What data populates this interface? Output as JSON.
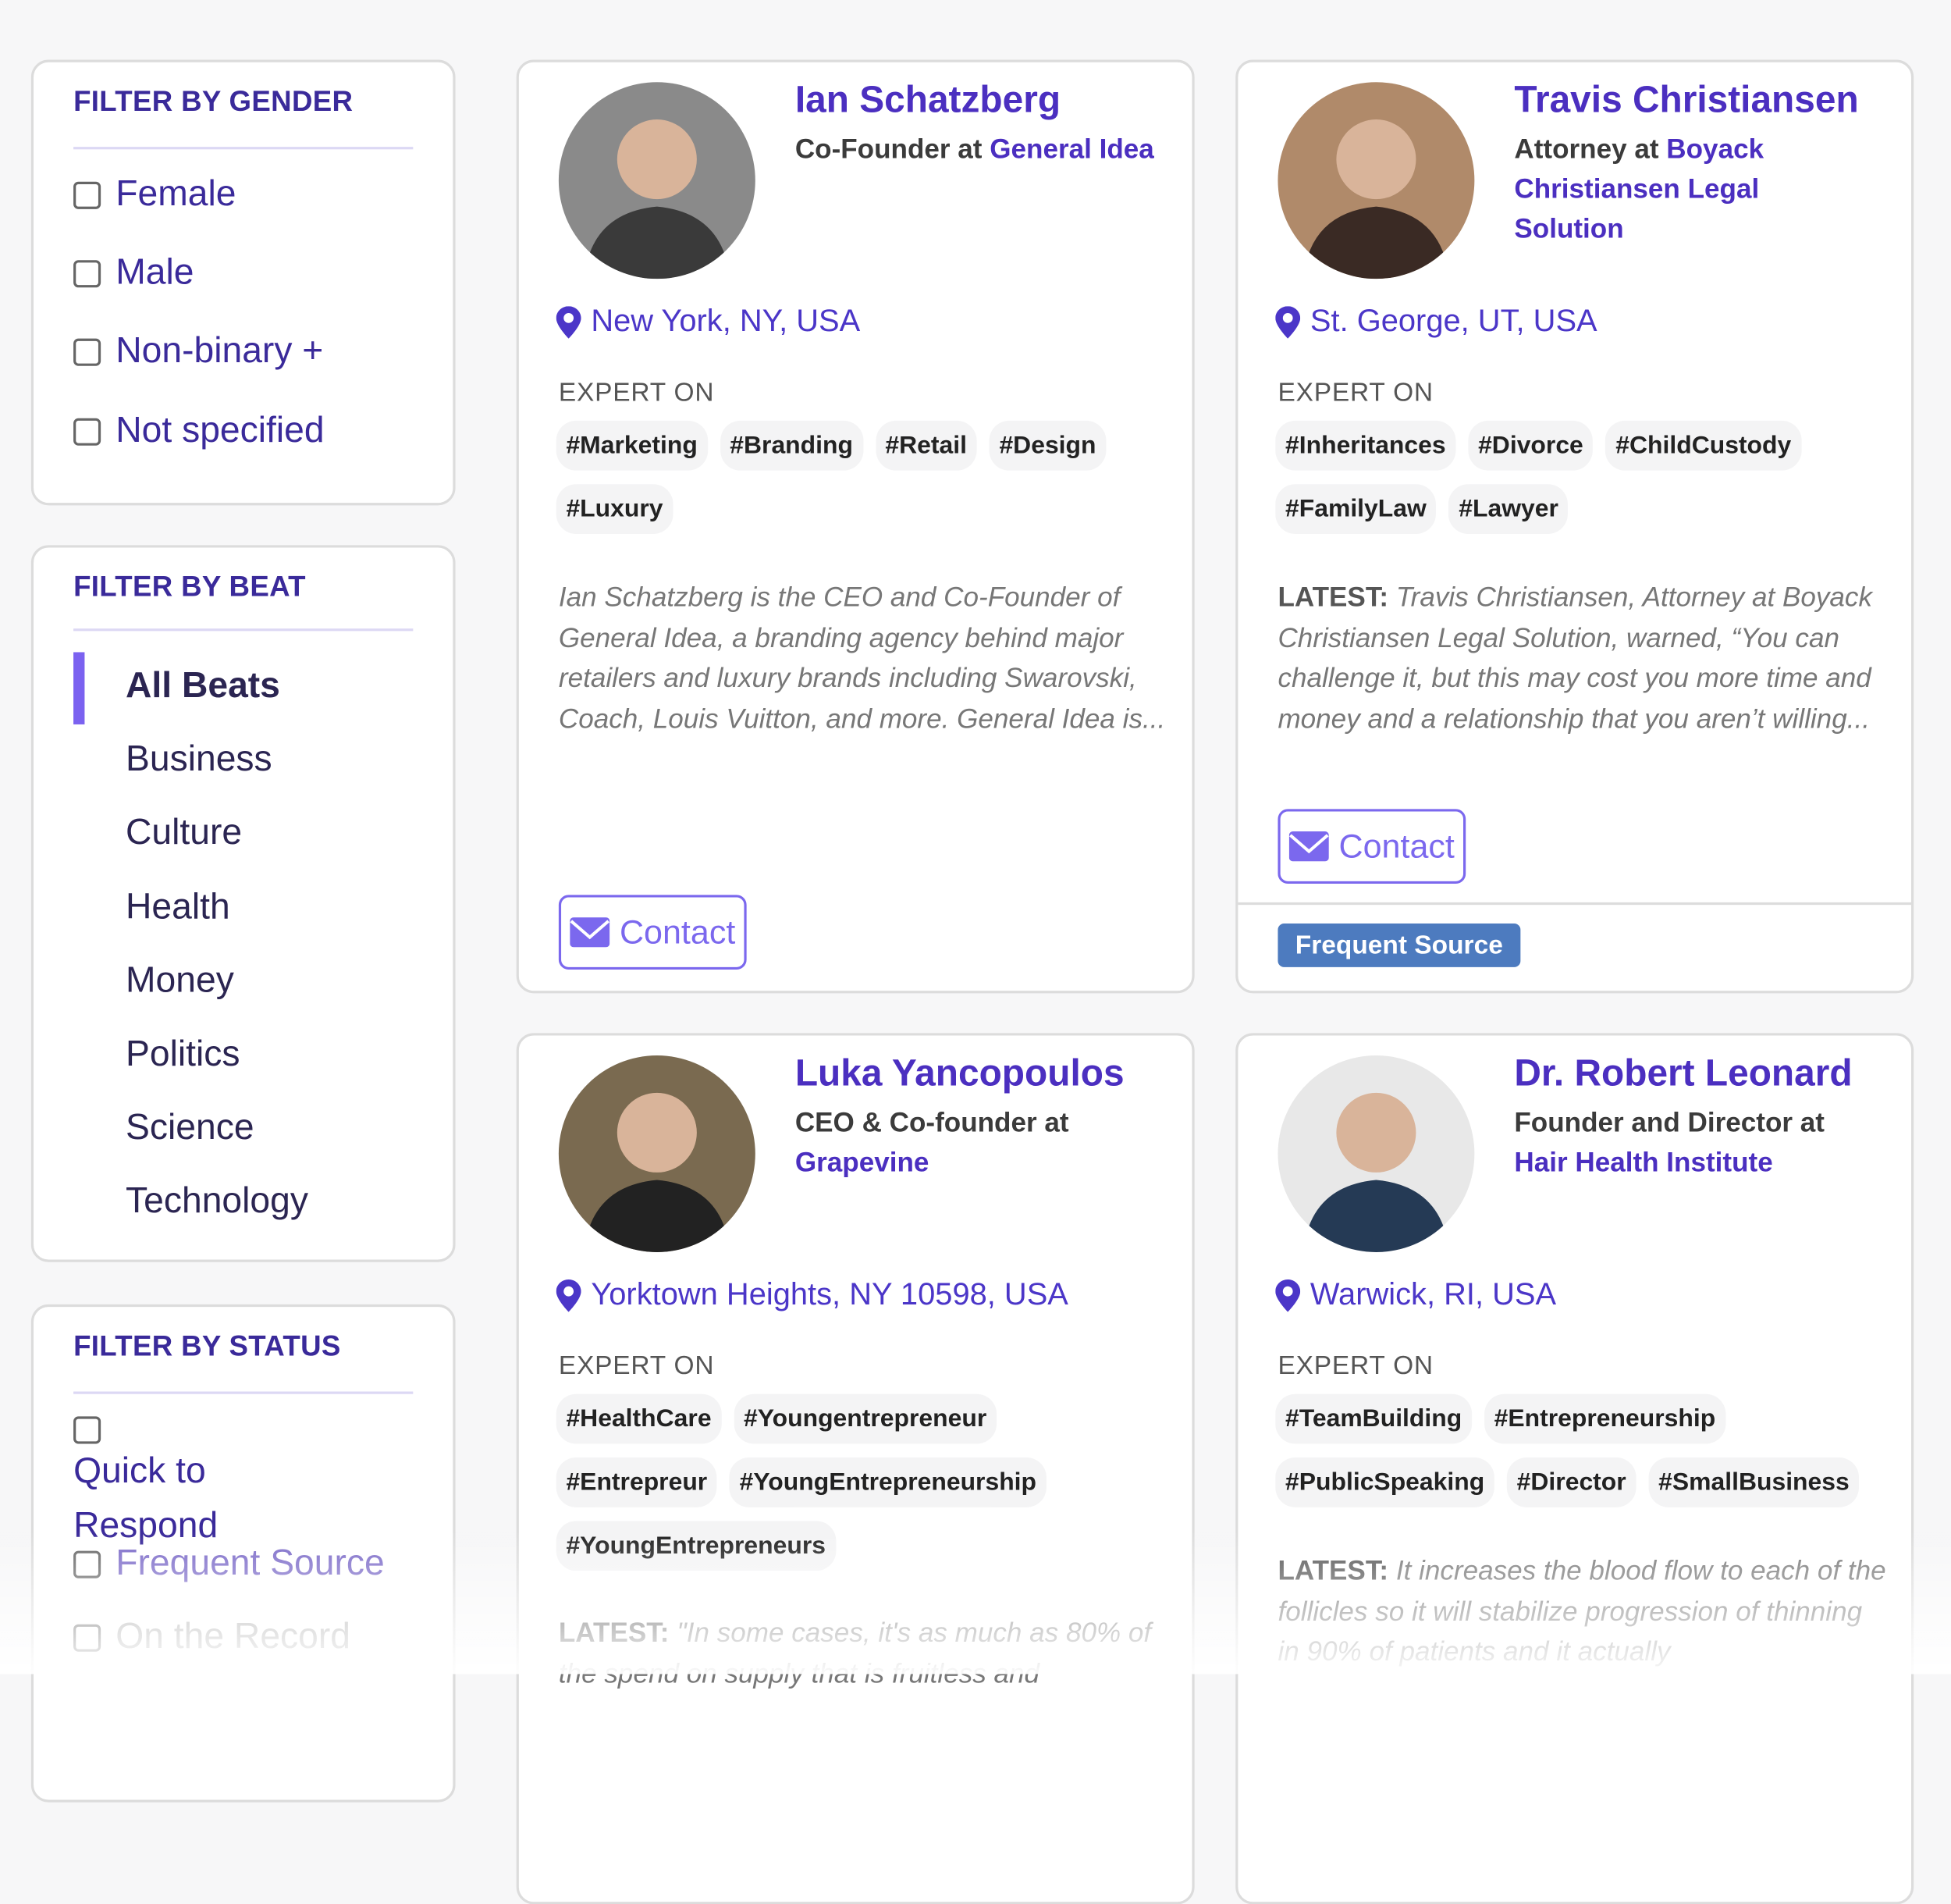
{
  "colors": {
    "accent": "#4b2fc0",
    "button": "#7b68ee",
    "badge": "#4d7bbf",
    "background": "#f7f7f8"
  },
  "filters": {
    "gender": {
      "title": "FILTER BY GENDER",
      "options": [
        "Female",
        "Male",
        "Non-binary +",
        "Not specified"
      ]
    },
    "beat": {
      "title": "FILTER BY BEAT",
      "active": "All Beats",
      "options": [
        "All Beats",
        "Business",
        "Culture",
        "Health",
        "Money",
        "Politics",
        "Science",
        "Technology"
      ]
    },
    "status": {
      "title": "FILTER BY STATUS",
      "options": [
        "Quick to Respond",
        "Frequent Source",
        "On the Record"
      ]
    }
  },
  "experts": [
    {
      "name": "Ian Schatzberg",
      "role": "Co-Founder at ",
      "company": "General Idea",
      "location": "New York, NY, USA",
      "expert_label": "EXPERT ON",
      "tags": [
        "#Marketing",
        "#Branding",
        "#Retail",
        "#Design",
        "#Luxury"
      ],
      "latest_label": "",
      "description": "Ian Schatzberg is the CEO and Co-Founder of General Idea, a branding agency behind major retailers and luxury brands including Swarovski, Coach, Louis Vuitton, and more. General Idea is...",
      "contact": "Contact",
      "badge": ""
    },
    {
      "name": "Travis Christiansen",
      "role": "Attorney at ",
      "company": "Boyack Christiansen Legal Solution",
      "location": "St. George, UT, USA",
      "expert_label": "EXPERT ON",
      "tags": [
        "#Inheritances",
        "#Divorce",
        "#ChildCustody",
        "#FamilyLaw",
        "#Lawyer"
      ],
      "latest_label": "LATEST:",
      "description": "Travis Christiansen, Attorney at Boyack Christiansen Legal Solution, warned, “You can challenge it, but this may cost you more time and money and a relationship that you aren’t willing...",
      "contact": "Contact",
      "badge": "Frequent Source"
    },
    {
      "name": "Luka Yancopoulos",
      "role": "CEO & Co-founder at ",
      "company": "Grapevine",
      "location": "Yorktown Heights, NY 10598, USA",
      "expert_label": "EXPERT ON",
      "tags": [
        "#HealthCare",
        "#Youngentrepreneur",
        "#Entrepreur",
        "#YoungEntrepreneurship",
        "#YoungEntrepreneurs"
      ],
      "latest_label": "LATEST:",
      "description": "\"In some cases, it's as much as 80% of the spend on supply that is fruitless and",
      "contact": "",
      "badge": ""
    },
    {
      "name": "Dr. Robert Leonard",
      "role": "Founder and Director at ",
      "company": "Hair Health Institute",
      "location": "Warwick, RI, USA",
      "expert_label": "EXPERT ON",
      "tags": [
        "#TeamBuilding",
        "#Entrepreneurship",
        "#PublicSpeaking",
        "#Director",
        "#SmallBusiness"
      ],
      "latest_label": "LATEST:",
      "description": "It increases the blood flow to each of the follicles so it will stabilize progression of thinning in 90% of patients and it actually",
      "contact": "",
      "badge": ""
    }
  ]
}
